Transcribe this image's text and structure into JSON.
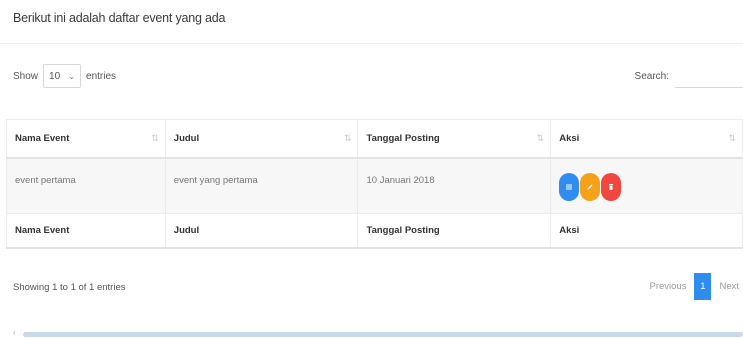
{
  "heading": "Berikut ini adalah daftar event yang ada",
  "length_control": {
    "prefix": "Show",
    "selected": "10",
    "suffix": "entries"
  },
  "search": {
    "label": "Search:",
    "value": ""
  },
  "table": {
    "columns": [
      "Nama Event",
      "Judul",
      "Tanggal Posting",
      "Aksi"
    ],
    "rows": [
      {
        "nama_event": "event pertama",
        "judul": "event yang pertama",
        "tanggal_posting": "10 Januari 2018"
      }
    ],
    "footer": [
      "Nama Event",
      "Judul",
      "Tanggal Posting",
      "Aksi"
    ]
  },
  "info": "Showing 1 to 1 of 1 entries",
  "pagination": {
    "previous": "Previous",
    "current": "1",
    "next": "Next"
  },
  "colors": {
    "accent": "#2f8cf0",
    "detail_button": "#2f8cf0",
    "edit_button": "#f5a11a",
    "delete_button": "#f2473f"
  },
  "icons": {
    "detail": "list-icon",
    "edit": "pencil-icon",
    "delete": "trash-icon"
  }
}
